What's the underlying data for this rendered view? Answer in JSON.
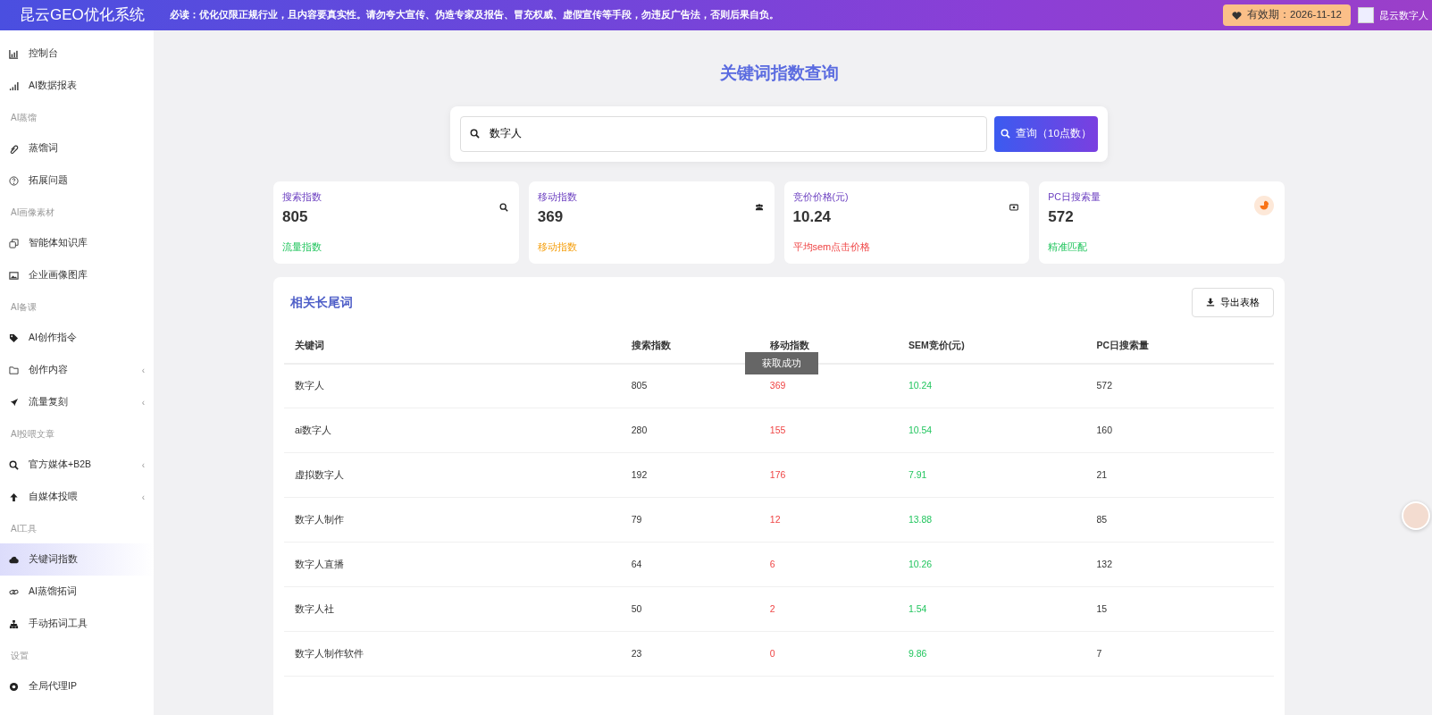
{
  "topbar": {
    "brand": "昆云GEO优化系统",
    "notice": "必读：优化仅限正规行业，且内容要真实性。请勿夸大宣传、伪造专家及报告、冒充权威、虚假宣传等手段，勿违反广告法，否则后果自负。",
    "expiry": "有效期：2026-11-12",
    "user": "昆云数字人"
  },
  "sidebar": {
    "items": [
      {
        "kind": "item",
        "label": "控制台",
        "selected": false
      },
      {
        "kind": "item",
        "label": "AI数据报表",
        "selected": false
      },
      {
        "kind": "section",
        "label": "AI蒸馏"
      },
      {
        "kind": "item",
        "label": "蒸馏词",
        "selected": false
      },
      {
        "kind": "item",
        "label": "拓展问题",
        "selected": false
      },
      {
        "kind": "section",
        "label": "AI画像素材"
      },
      {
        "kind": "item",
        "label": "智能体知识库",
        "selected": false
      },
      {
        "kind": "item",
        "label": "企业画像图库",
        "selected": false
      },
      {
        "kind": "section",
        "label": "AI备课"
      },
      {
        "kind": "item",
        "label": "AI创作指令",
        "selected": false
      },
      {
        "kind": "item",
        "label": "创作内容",
        "selected": false,
        "chevron": "‹"
      },
      {
        "kind": "item",
        "label": "流量复刻",
        "selected": false,
        "chevron": "‹"
      },
      {
        "kind": "section",
        "label": "AI投喂文章"
      },
      {
        "kind": "item",
        "label": "官方媒体+B2B",
        "selected": false,
        "chevron": "‹"
      },
      {
        "kind": "item",
        "label": "自媒体投喂",
        "selected": false,
        "chevron": "‹"
      },
      {
        "kind": "section",
        "label": "AI工具"
      },
      {
        "kind": "item",
        "label": "关键词指数",
        "selected": true
      },
      {
        "kind": "item",
        "label": "AI蒸馏拓词",
        "selected": false
      },
      {
        "kind": "item",
        "label": "手动拓词工具",
        "selected": false
      },
      {
        "kind": "section",
        "label": "设置"
      },
      {
        "kind": "item",
        "label": "全局代理IP",
        "selected": false
      }
    ]
  },
  "page_title": "关键词指数查询",
  "search": {
    "value": "数字人",
    "button": "查询（10点数）"
  },
  "stats": [
    {
      "label": "搜索指数",
      "value": "805",
      "note": "流量指数"
    },
    {
      "label": "移动指数",
      "value": "369",
      "note": "移动指数"
    },
    {
      "label": "竞价价格(元)",
      "value": "10.24",
      "note": "平均sem点击价格"
    },
    {
      "label": "PC日搜索量",
      "value": "572",
      "note": "精准匹配"
    }
  ],
  "table": {
    "title": "相关长尾词",
    "export_button": "导出表格",
    "columns": [
      "关键词",
      "搜索指数",
      "移动指数",
      "SEM竞价(元)",
      "PC日搜索量"
    ],
    "rows": [
      [
        "数字人",
        "805",
        "369",
        "10.24",
        "572"
      ],
      [
        "ai数字人",
        "280",
        "155",
        "10.54",
        "160"
      ],
      [
        "虚拟数字人",
        "192",
        "176",
        "7.91",
        "21"
      ],
      [
        "数字人制作",
        "79",
        "12",
        "13.88",
        "85"
      ],
      [
        "数字人直播",
        "64",
        "6",
        "10.26",
        "132"
      ],
      [
        "数字人社",
        "50",
        "2",
        "1.54",
        "15"
      ],
      [
        "数字人制作软件",
        "23",
        "0",
        "9.86",
        "7"
      ]
    ]
  },
  "toast": "获取成功"
}
